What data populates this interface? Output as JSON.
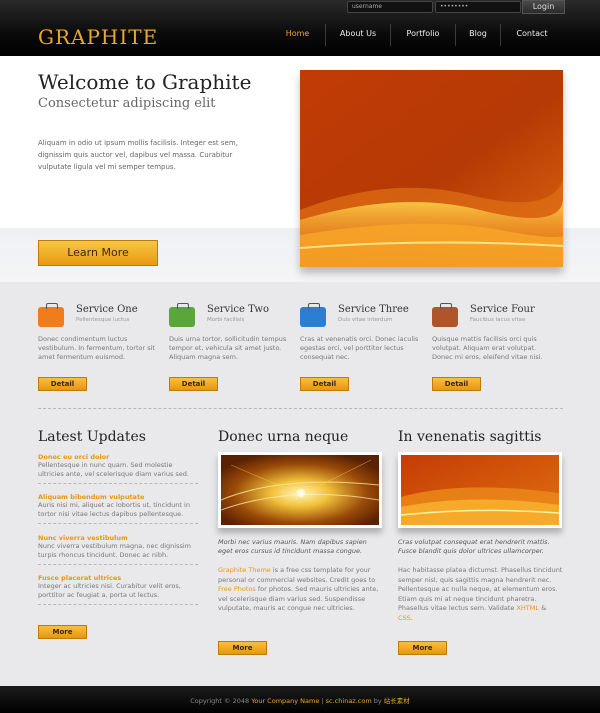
{
  "header": {
    "logo": "GRAPHITE",
    "login": {
      "username_placeholder": "username",
      "password_placeholder": "••••••••",
      "login_label": "Login"
    },
    "nav": [
      "Home",
      "About Us",
      "Portfolio",
      "Blog",
      "Contact"
    ],
    "nav_active_color": "#e8a82a"
  },
  "hero": {
    "title": "Welcome to Graphite",
    "subtitle": "Consectetur adipiscing elit",
    "text": "Aliquam in odio ut ipsum mollis facilisis. Integer est sem, dignissim quis auctor vel, dapibus vel massa. Curabitur vulputate ligula vel mi semper tempus.",
    "button": "Learn More"
  },
  "services": [
    {
      "title": "Service One",
      "sub": "Pellentesque luctus",
      "text": "Donec condimentum luctus vestibulum. In fermentum, tortor sit amet fermentum euismod.",
      "button": "Detail",
      "icon": "briefcase-orange-icon",
      "color": "#f07c1c"
    },
    {
      "title": "Service Two",
      "sub": "Morbi facilisis",
      "text": "Duis urna tortor, sollicitudin tempus tempor et, vehicula sit amet justo. Aliquam magna sem.",
      "button": "Detail",
      "icon": "briefcase-green-icon",
      "color": "#5aa63a"
    },
    {
      "title": "Service Three",
      "sub": "Duis vitae interdum",
      "text": "Cras at venenatis orci. Donec iaculis egestas orci, vel porttitor lectus consequat nec.",
      "button": "Detail",
      "icon": "briefcase-blue-icon",
      "color": "#2b7fd2"
    },
    {
      "title": "Service Four",
      "sub": "Faucibus lacus vitae",
      "text": "Quisque mattis facilisis orci quis volutpat. Aliquam erat volutpat. Donec mi eros, eleifend vitae nisi.",
      "button": "Detail",
      "icon": "briefcase-brown-icon",
      "color": "#b0542a"
    }
  ],
  "updates": {
    "title": "Latest Updates",
    "items": [
      {
        "title": "Donec eu orci dolor",
        "text": "Pellentesque in nunc quam. Sed molestie ultricies ante, vel scelerisque diam varius sed."
      },
      {
        "title": "Aliquam bibendum vulputate",
        "text": "Auris nisi mi, aliquet ac lobortis ut, tincidunt in tortor nisi vitae lectus dapibus pellentesque."
      },
      {
        "title": "Nunc viverra vestibulum",
        "text": "Nunc viverra vestibulum magna, nec dignissim turpis rhoncus tincidunt. Donec ac nibh."
      },
      {
        "title": "Fusce placerat ultrices",
        "text": "Integer ac ultricies nisi. Curabitur velit eros, porttitor ac feugiat a, porta ut lectus."
      }
    ],
    "button": "More"
  },
  "col2": {
    "title": "Donec urna neque",
    "caption": "Morbi nec varius mauris. Nam dapibus sapien eget eros cursus id tincidunt massa congue.",
    "text_link1": "Graphite Theme",
    "text_part1": " is a free css template for your personal or commercial websites. Credit goes to ",
    "text_link2": "Free Photos",
    "text_part2": " for photos. Sed mauris ultricies ante, vel scelerisque diam varius sed. Suspendisse vulputate, mauris ac congue nec ultricies.",
    "button": "More"
  },
  "col3": {
    "title": "In venenatis sagittis",
    "caption": "Cras volutpat consequat erat hendrerit mattis. Fusce blandit quis dolor ultrices ullamcorper.",
    "text_part1": "Hac habitasse platea dictumst. Phasellus tincidunt semper nisl, quis sagittis magna hendrerit nec. Pellentesque ac nulla neque, at elementum eros. Etiam quis mi at neque tincidunt pharetra. Phasellus vitae lectus sem. Validate ",
    "text_link1": "XHTML",
    "text_amp": " & ",
    "text_link2": "CSS",
    "text_end": ".",
    "button": "More"
  },
  "footer": {
    "prefix": "Copyright © 2048 ",
    "company": "Your Company Name",
    "sep": " | ",
    "site": "sc.chinaz.com",
    "by": " by ",
    "author": "站长素材"
  }
}
